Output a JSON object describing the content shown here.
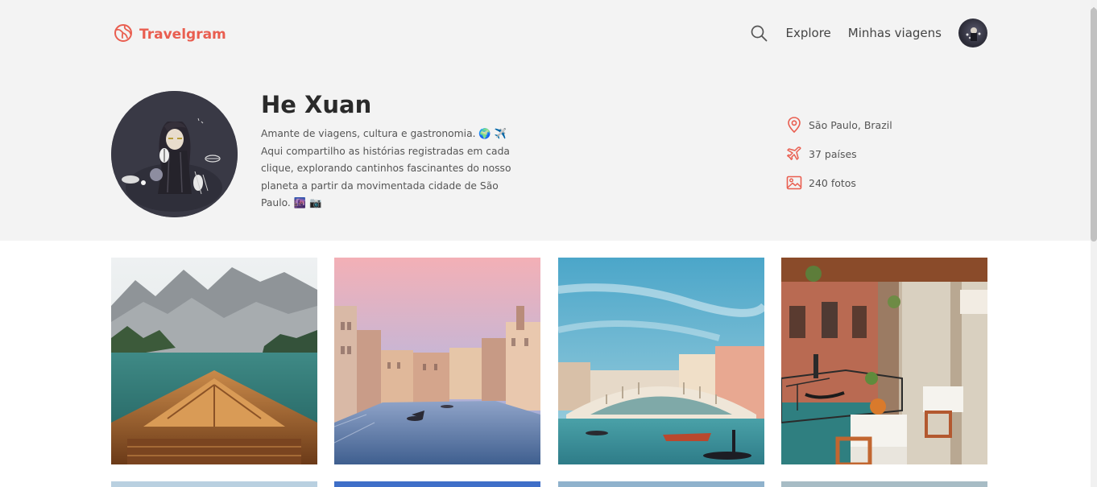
{
  "app": {
    "name": "Travelgram",
    "brand_color": "#e95e50"
  },
  "nav": {
    "search_icon": "search-icon",
    "links": [
      "Explore",
      "Minhas viagens"
    ]
  },
  "profile": {
    "name": "He Xuan",
    "bio": "Amante de viagens, cultura e gastronomia. 🌍 ✈️ Aqui compartilho as histórias registradas em cada clique, explorando cantinhos fascinantes do nosso planeta a partir da movimentada cidade de São Paulo. 🌆 📷",
    "location": "São Paulo, Brazil",
    "countries": "37 países",
    "photos": "240 fotos"
  },
  "gallery": {
    "items": [
      {
        "subject": "mountain lake with boat bow"
      },
      {
        "subject": "venice canal at sunset"
      },
      {
        "subject": "rialto bridge venice"
      },
      {
        "subject": "venice canal restaurant terrace"
      }
    ]
  }
}
